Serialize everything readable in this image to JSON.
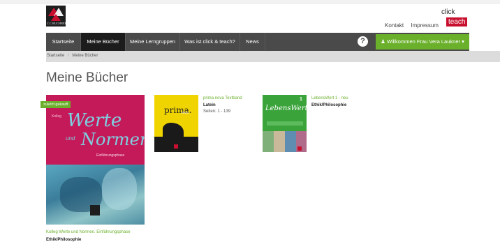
{
  "brand": {
    "publisher_logo_text": "C.C.BUCHNER",
    "app_logo_line1": "click",
    "app_logo_line2": "teach"
  },
  "header": {
    "links": [
      "Kontakt",
      "Impressum"
    ]
  },
  "nav": {
    "items": [
      "Startseite",
      "Meine Bücher",
      "Meine Lerngruppen",
      "Was ist click & teach?",
      "News"
    ],
    "active_index": 1,
    "help_icon": "?",
    "welcome_label": "Willkommen Frau Vera Laukner"
  },
  "breadcrumb": {
    "home": "Startseite",
    "separator": "/",
    "current": "Meine Bücher"
  },
  "page": {
    "title": "Meine Bücher"
  },
  "books": [
    {
      "badge": "zuletzt gekauft",
      "cover_text_kolleg": "Kolleg",
      "cover_text_1": "Werte",
      "cover_text_2": "und",
      "cover_text_3": "Normen",
      "cover_text_sub": "Einführungsphase",
      "title": "Kolleg Werte und Normen. Einführungsphase",
      "subject": "Ethik/Philosophie"
    },
    {
      "cover_text_1": "prima.",
      "cover_text_2": "nova",
      "title": "prima.nova Textband",
      "subject": "Latein",
      "pages": "Seiten: 1 - 139"
    },
    {
      "cover_text_1": "LebensWert",
      "cover_number": "1",
      "title": "LebensWert 1 - neu",
      "subject": "Ethik/Philosophie"
    }
  ],
  "colors": {
    "accent_green": "#6ab02b",
    "nav_bg": "#4a4a4a",
    "nav_active_bg": "#1c1c1c",
    "brand_red": "#c8102e"
  }
}
